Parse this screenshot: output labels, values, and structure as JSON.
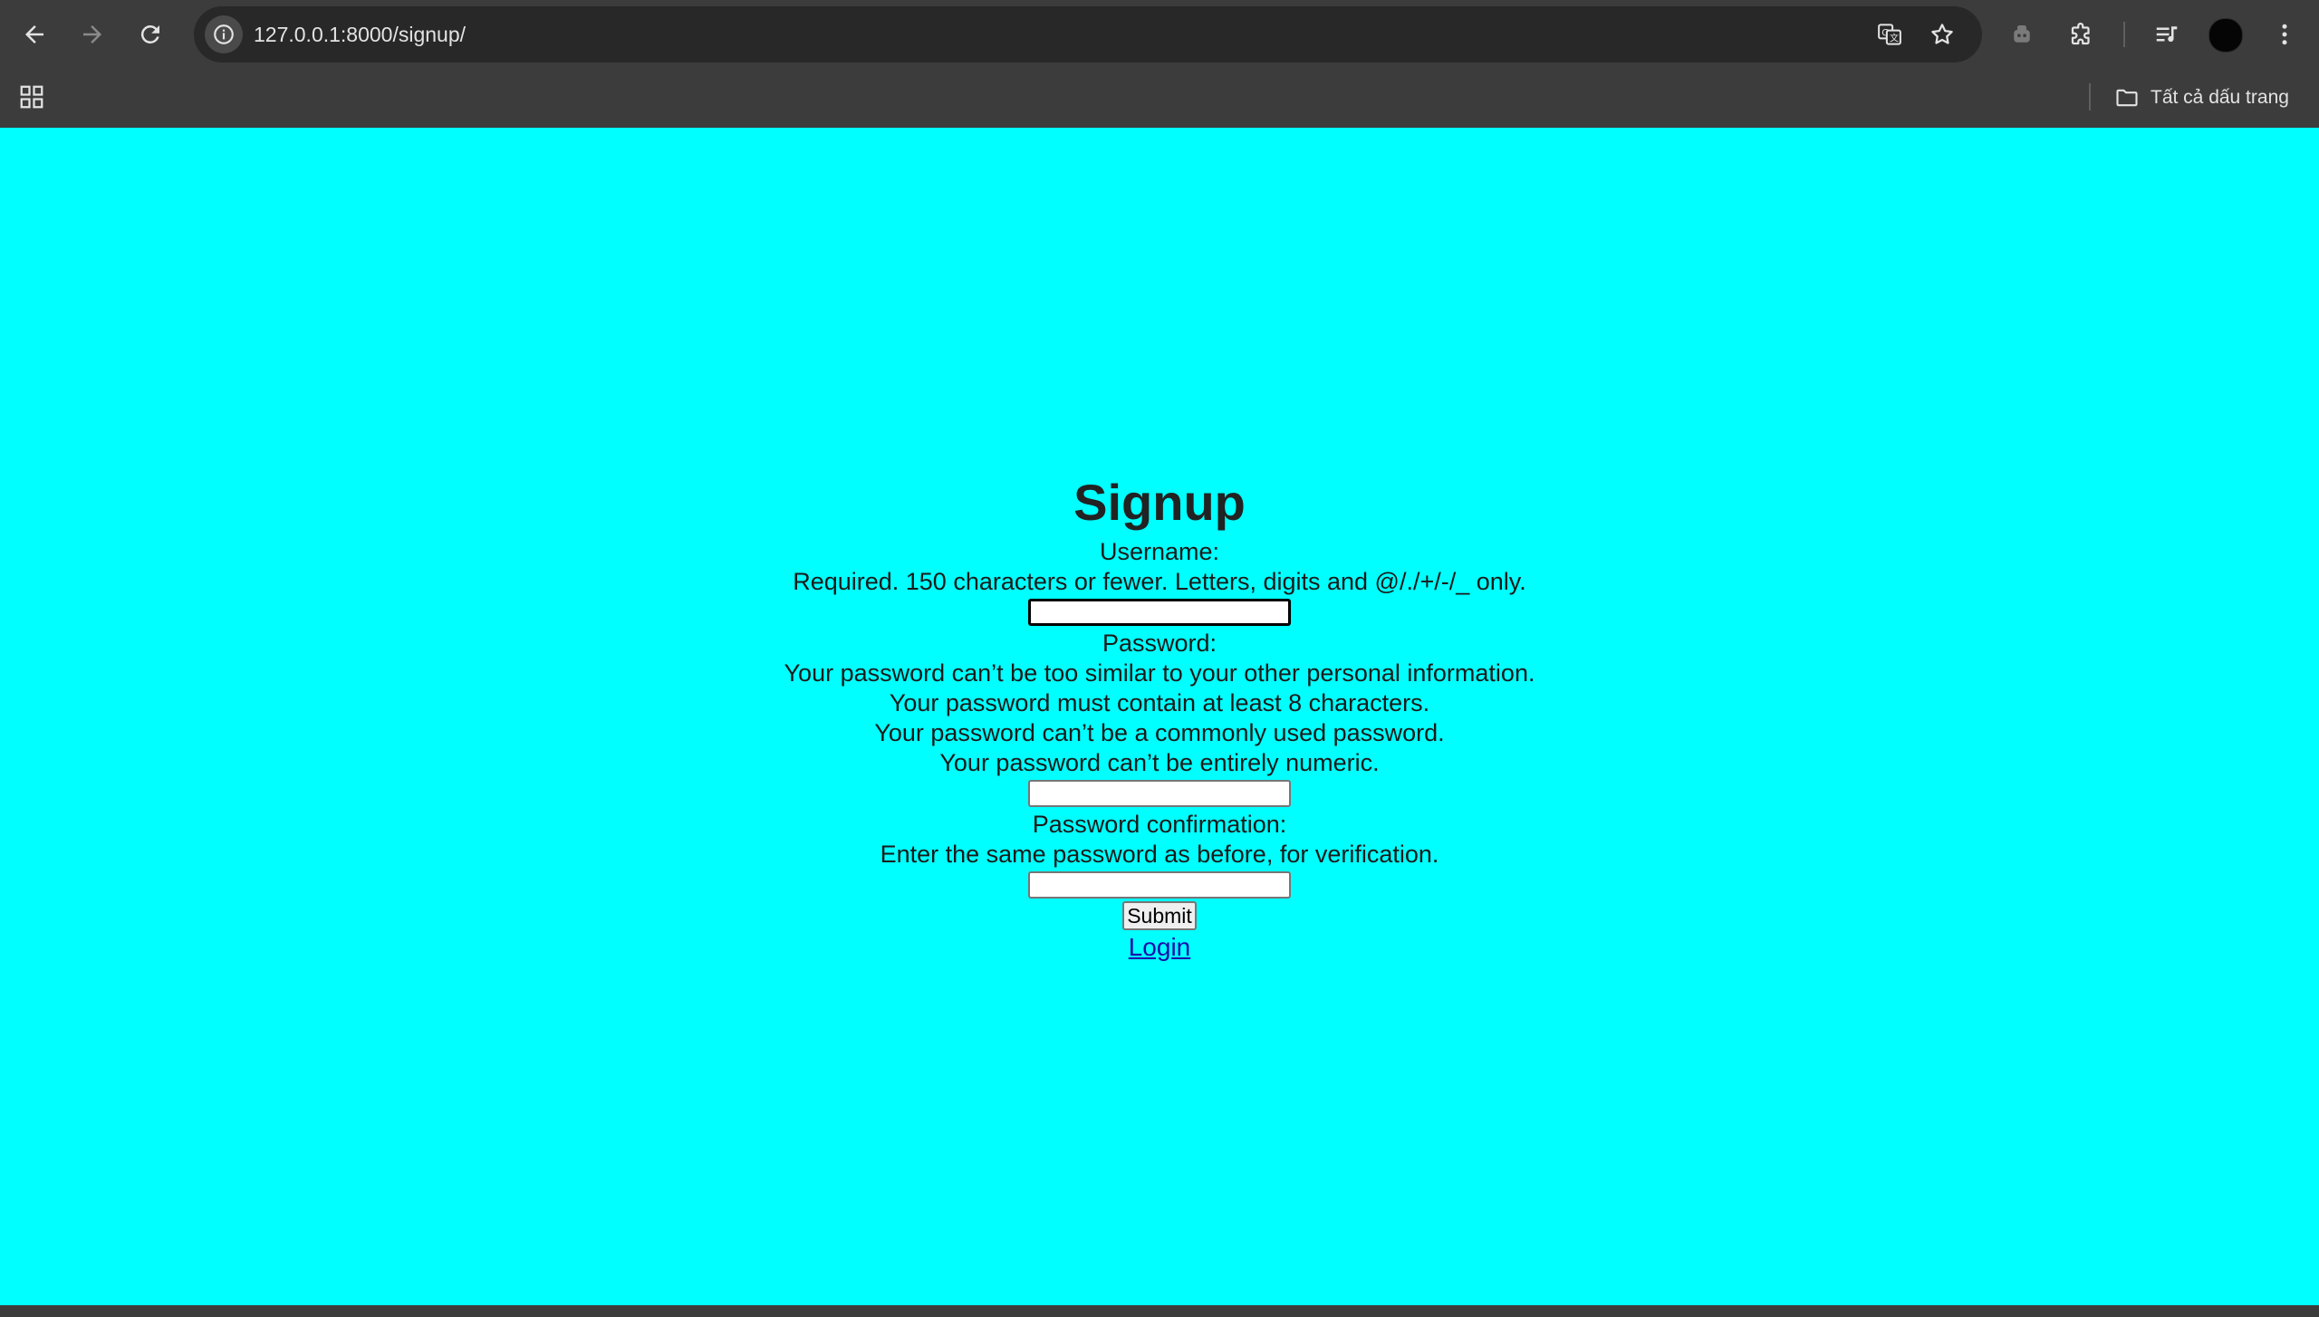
{
  "browser": {
    "url": "127.0.0.1:8000/signup/",
    "bookmarks_label": "Tất cả dấu trang",
    "icons": [
      "back-icon",
      "forward-icon",
      "reload-icon",
      "site-info-icon",
      "translate-icon",
      "star-icon",
      "robot-icon",
      "extensions-icon",
      "media-icon",
      "menu-icon",
      "apps-icon",
      "folder-icon"
    ]
  },
  "page": {
    "background_color": "#00ffff",
    "title": "Signup",
    "username": {
      "label": "Username:",
      "help": "Required. 150 characters or fewer. Letters, digits and @/./+/-/_ only.",
      "value": ""
    },
    "password": {
      "label": "Password:",
      "help": [
        "Your password can’t be too similar to your other personal information.",
        "Your password must contain at least 8 characters.",
        "Your password can’t be a commonly used password.",
        "Your password can’t be entirely numeric."
      ],
      "value": ""
    },
    "password_confirmation": {
      "label": "Password confirmation:",
      "help": "Enter the same password as before, for verification.",
      "value": ""
    },
    "submit_label": "Submit",
    "login_link": "Login"
  }
}
